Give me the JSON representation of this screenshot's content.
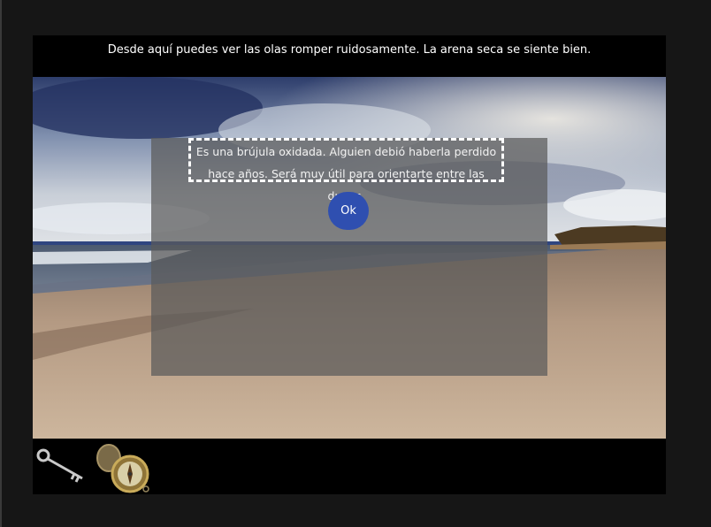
{
  "narration": "Desde aquí puedes ver las olas romper ruidosamente. La arena seca se siente bien.",
  "dialog": {
    "message": "Es una brújula oxidada. Alguien debió haberla perdido hace años. Será muy útil para orientarte entre las dunas.",
    "ok_label": "Ok"
  },
  "scene": {
    "name": "beach-scene"
  },
  "inventory": {
    "items": [
      {
        "icon": "key-icon"
      },
      {
        "icon": "compass-icon"
      }
    ]
  }
}
